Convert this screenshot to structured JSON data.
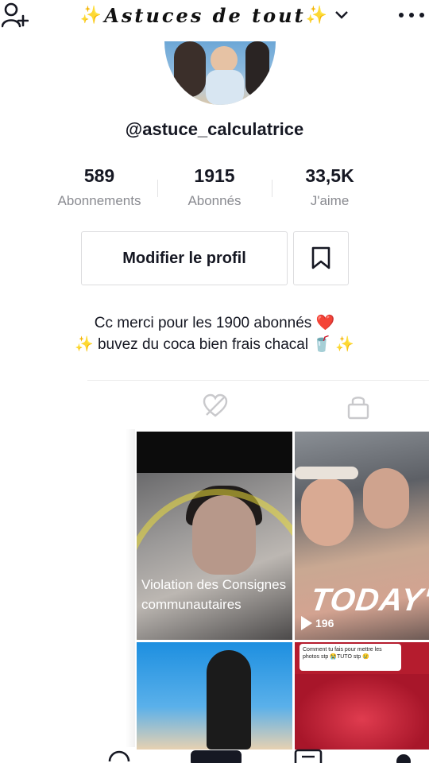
{
  "header": {
    "title": "Astuces de tout",
    "sparkle_left": "✨",
    "sparkle_right": "✨",
    "title_chevron": "chevron-down-icon",
    "left_icon": "add-user-icon",
    "right_icon": "more-icon"
  },
  "profile": {
    "username": "@astuce_calculatrice",
    "stats": [
      {
        "value": "589",
        "label": "Abonnements"
      },
      {
        "value": "1915",
        "label": "Abonnés"
      },
      {
        "value": "33,5K",
        "label": "J'aime"
      }
    ],
    "edit_button": "Modifier le profil",
    "bio_line1": "Cc merci pour les 1900 abonnés ❤️",
    "bio_line2": "✨ buvez du coca bien frais chacal 🥤 ✨"
  },
  "tabs": {
    "liked_icon": "hidden-heart-icon",
    "private_icon": "lock-icon"
  },
  "grid": {
    "video1_overlay": "Violation des Consignes communautaires",
    "video2_text": "TODAY'S",
    "video2_views": "196",
    "video4_note": "Comment tu fais pour mettre les photos stp 😭TUTO stp 😢"
  },
  "colors": {
    "accent_yellow": "#f5c400",
    "text_primary": "#161823",
    "text_secondary": "#8a8b91",
    "border": "#dcdcde",
    "heart_red": "#e8192c"
  }
}
